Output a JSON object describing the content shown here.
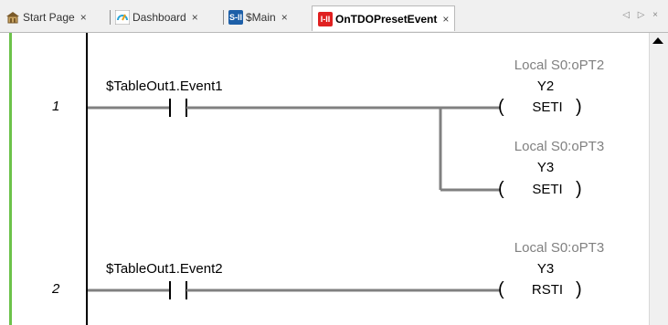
{
  "tabs": [
    {
      "label": "Start Page",
      "icon": "home-icon",
      "close": "×"
    },
    {
      "label": "Dashboard",
      "icon": "dashboard-icon",
      "close": "×"
    },
    {
      "label": "$Main",
      "icon": "ladder-program-icon",
      "icon_text": "S-II",
      "close": "×"
    },
    {
      "label": "OnTDOPresetEvent",
      "icon": "ladder-program-icon",
      "icon_text": "I-II",
      "close": "×",
      "active": true
    }
  ],
  "tab_nav": "◁ ▷ ×",
  "rungs": [
    {
      "number": "1",
      "contact_label": "$TableOut1.Event1",
      "coils": [
        {
          "nickname": "Local S0:oPT2",
          "address": "Y2",
          "instruction": "SETI"
        },
        {
          "nickname": "Local S0:oPT3",
          "address": "Y3",
          "instruction": "SETI"
        }
      ]
    },
    {
      "number": "2",
      "contact_label": "$TableOut1.Event2",
      "coils": [
        {
          "nickname": "Local S0:oPT3",
          "address": "Y3",
          "instruction": "RSTI"
        }
      ]
    }
  ],
  "colors": {
    "rung_active": "#6cc24a",
    "nickname": "#808080",
    "active_tab_icon": "#e02020"
  }
}
